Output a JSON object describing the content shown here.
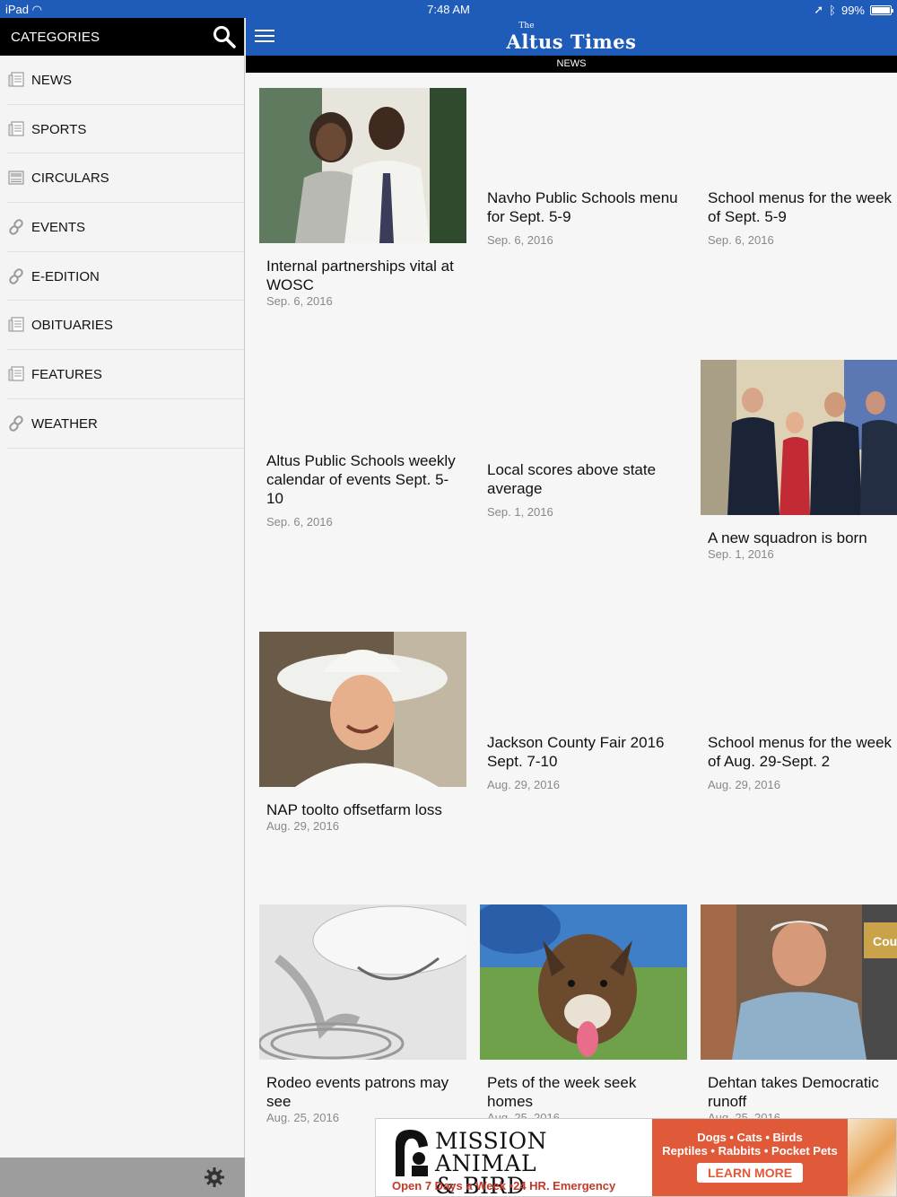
{
  "status": {
    "device": "iPad",
    "time": "7:48 AM",
    "battery": "99%"
  },
  "sidebar": {
    "title": "CATEGORIES",
    "items": [
      {
        "label": "NEWS",
        "icon": "newspaper-icon"
      },
      {
        "label": "SPORTS",
        "icon": "newspaper-icon"
      },
      {
        "label": "CIRCULARS",
        "icon": "circular-icon"
      },
      {
        "label": "EVENTS",
        "icon": "link-icon"
      },
      {
        "label": "E-EDITION",
        "icon": "link-icon"
      },
      {
        "label": "OBITUARIES",
        "icon": "newspaper-icon"
      },
      {
        "label": "FEATURES",
        "icon": "newspaper-icon"
      },
      {
        "label": "WEATHER",
        "icon": "link-icon"
      }
    ]
  },
  "header": {
    "masthead_the": "The",
    "masthead_name": "Altus Times",
    "section": "NEWS"
  },
  "articles": [
    {
      "headline": "Internal partnerships vital at WOSC",
      "date": "Sep. 6, 2016",
      "photo": "couple-photo"
    },
    {
      "headline": "Navho Public Schools menu for Sept. 5-9",
      "date": "Sep. 6, 2016"
    },
    {
      "headline": "School menus for the week of Sept. 5-9",
      "date": "Sep. 6, 2016"
    },
    {
      "headline": "Altus Public Schools weekly calendar of events Sept. 5-10",
      "date": "Sep. 6, 2016"
    },
    {
      "headline": "Local scores above state average",
      "date": "Sep. 1, 2016"
    },
    {
      "headline": "A new squadron is born",
      "date": "Sep. 1, 2016",
      "photo": "military-photo"
    },
    {
      "headline": "NAP toolto offsetfarm loss",
      "date": "Aug. 29, 2016",
      "photo": "cowboy-photo"
    },
    {
      "headline": "Jackson County Fair 2016 Sept. 7-10",
      "date": "Aug. 29, 2016"
    },
    {
      "headline": "School menus for the week of Aug. 29-Sept. 2",
      "date": "Aug. 29, 2016"
    },
    {
      "headline": "Rodeo events patrons may see",
      "date": "Aug. 25, 2016",
      "photo": "hat-rope-photo"
    },
    {
      "headline": "Pets of the week seek homes",
      "date": "Aug. 25, 2016",
      "photo": "dog-photo"
    },
    {
      "headline": "Dehtan takes Democratic runoff",
      "date": "Aug. 25, 2016",
      "photo": "man-photo",
      "photo_sign": "Cou"
    }
  ],
  "ad": {
    "name_line1": "MISSION ANIMAL",
    "name_line2": "& BIRD HOSPITAL",
    "hours": "Open 7 Days a Week •24 HR. Emergency",
    "animals1": "Dogs • Cats • Birds",
    "animals2": "Reptiles • Rabbits • Pocket Pets",
    "cta": "LEARN MORE"
  },
  "colors": {
    "brand_blue": "#1f5bb8",
    "header_black": "#000000",
    "ad_orange": "#e05a3a"
  }
}
